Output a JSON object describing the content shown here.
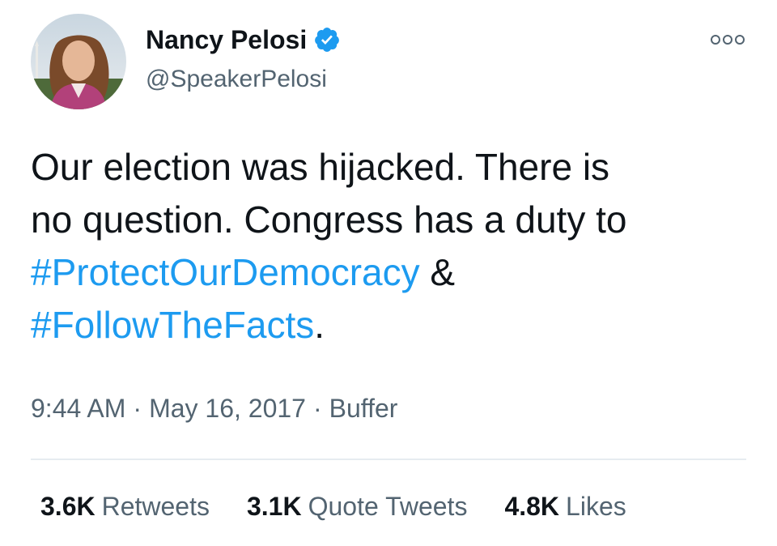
{
  "author": {
    "display_name": "Nancy Pelosi",
    "handle": "@SpeakerPelosi",
    "verified_icon": "verified-badge-icon",
    "avatar_icon": "profile-photo"
  },
  "tweet": {
    "text_line1": "Our election was hijacked. There is",
    "text_line2": "no question. Congress has a duty to",
    "hashtag1": "#ProtectOurDemocracy",
    "ampersand": " &",
    "hashtag2": "#FollowTheFacts",
    "period": "."
  },
  "meta": {
    "time": "9:44 AM",
    "separator": "·",
    "date": "May 16, 2017",
    "source": "Buffer"
  },
  "stats": {
    "retweets_count": "3.6K",
    "retweets_label": "Retweets",
    "quotes_count": "3.1K",
    "quotes_label": "Quote Tweets",
    "likes_count": "4.8K",
    "likes_label": "Likes"
  },
  "colors": {
    "hashtag": "#1d9bf0",
    "secondary_text": "#536471",
    "primary_text": "#0f1419",
    "divider": "#e6ecf0"
  },
  "more_icon": "more-options-icon"
}
